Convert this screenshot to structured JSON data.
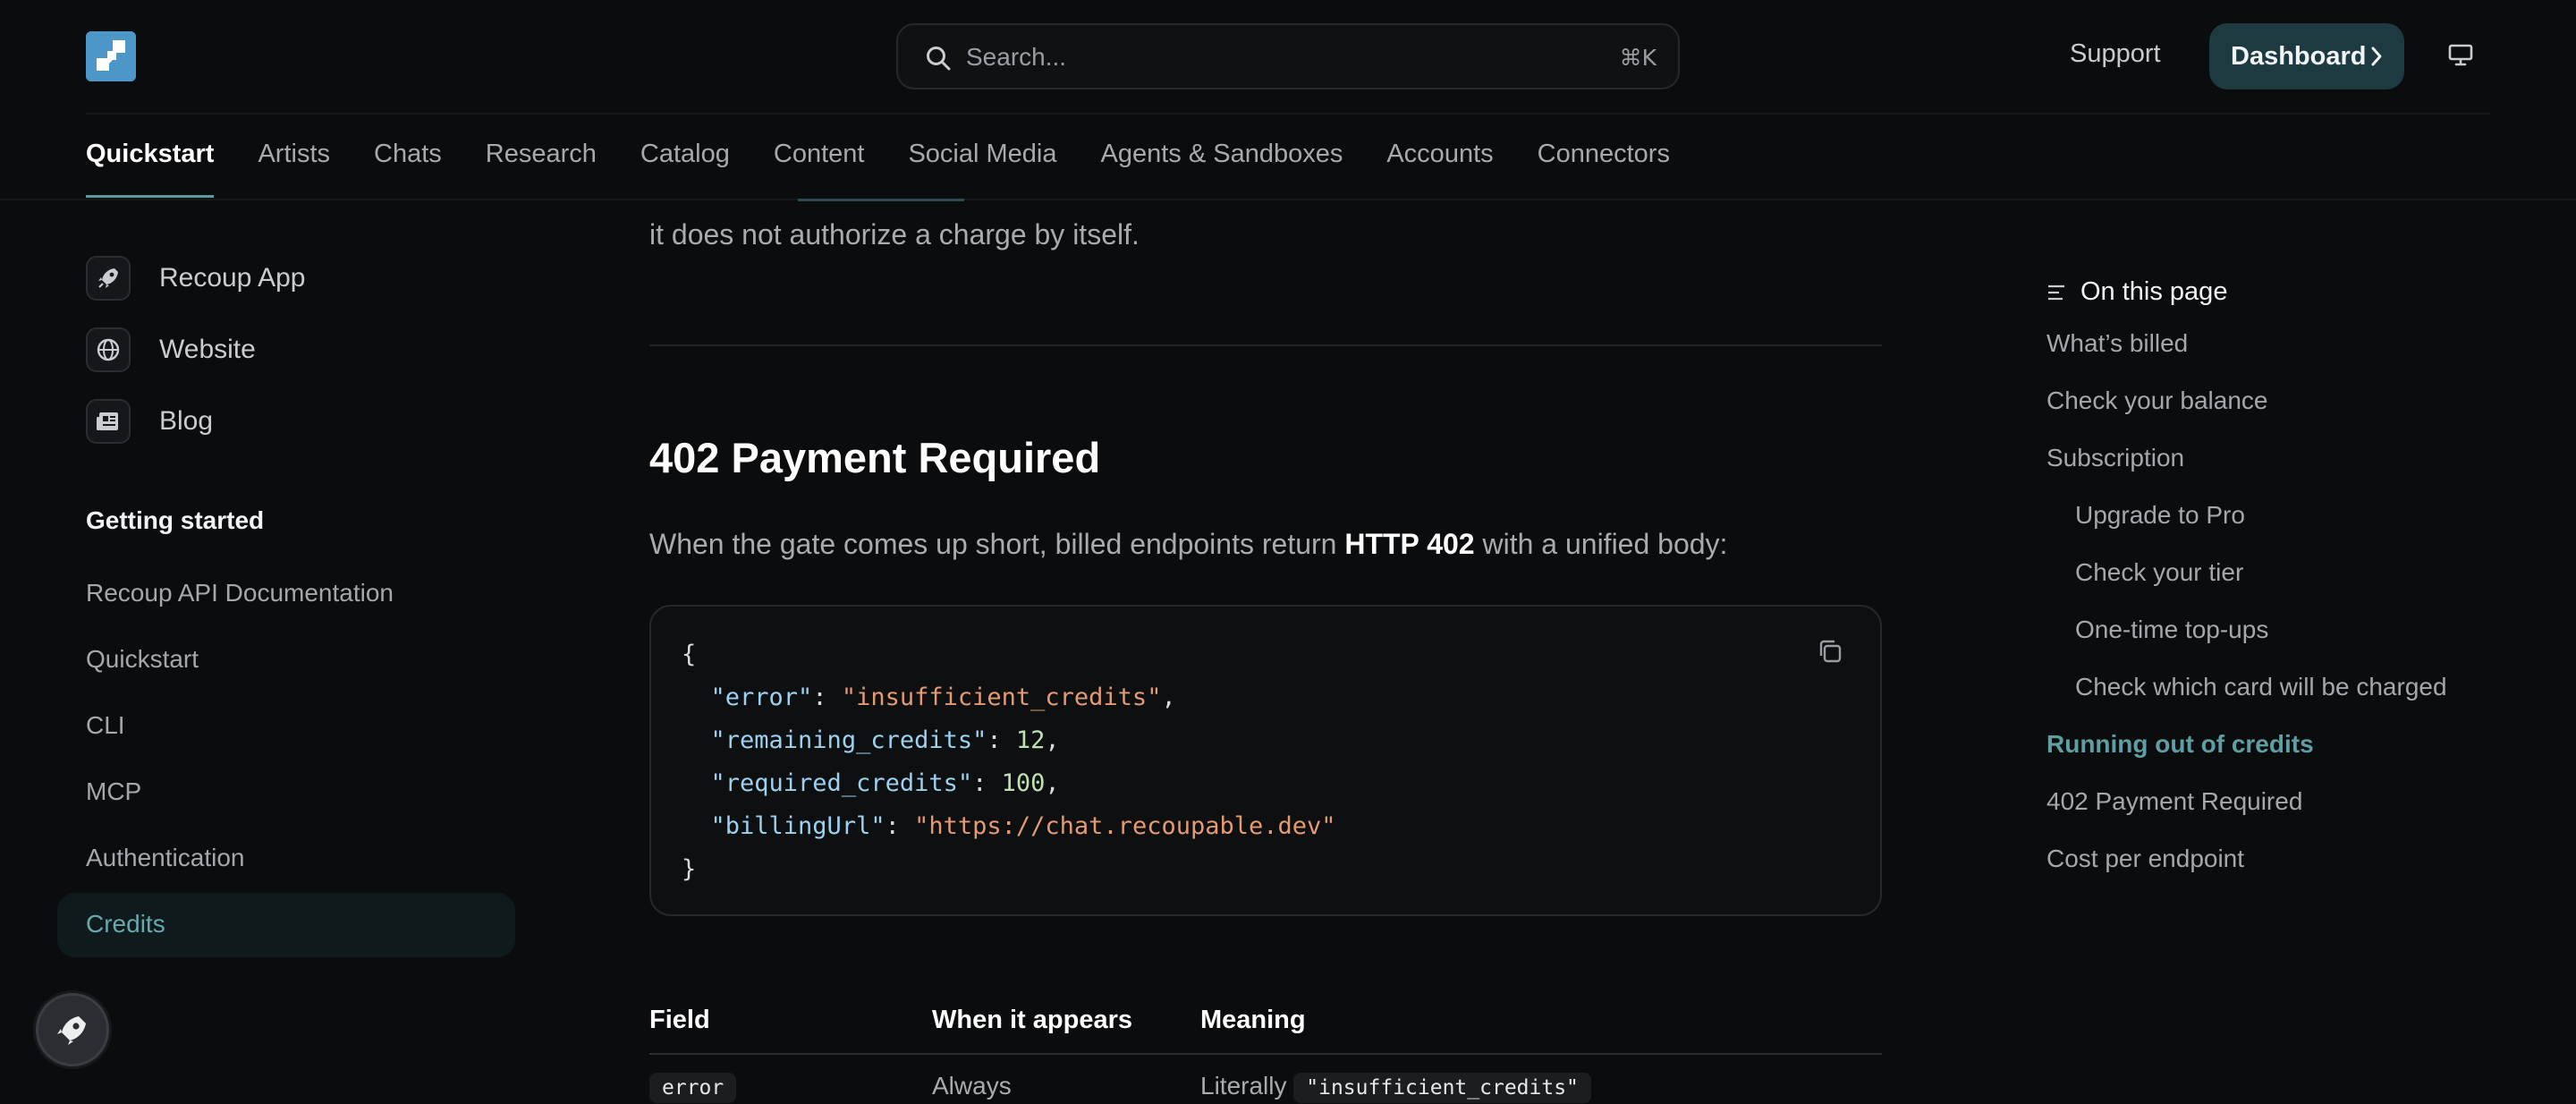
{
  "header": {
    "search_placeholder": "Search...",
    "search_shortcut": "⌘K",
    "support_label": "Support",
    "dashboard_label": "Dashboard"
  },
  "tabs": [
    {
      "label": "Quickstart",
      "active": true
    },
    {
      "label": "Artists"
    },
    {
      "label": "Chats"
    },
    {
      "label": "Research"
    },
    {
      "label": "Catalog"
    },
    {
      "label": "Content"
    },
    {
      "label": "Social Media"
    },
    {
      "label": "Agents & Sandboxes"
    },
    {
      "label": "Accounts"
    },
    {
      "label": "Connectors"
    }
  ],
  "sidebar": {
    "links": [
      {
        "label": "Recoup App",
        "icon": "rocket-icon"
      },
      {
        "label": "Website",
        "icon": "globe-icon"
      },
      {
        "label": "Blog",
        "icon": "newspaper-icon"
      }
    ],
    "section_title": "Getting started",
    "items": [
      {
        "label": "Recoup API Documentation"
      },
      {
        "label": "Quickstart"
      },
      {
        "label": "CLI"
      },
      {
        "label": "MCP"
      },
      {
        "label": "Authentication"
      },
      {
        "label": "Credits",
        "active": true
      }
    ]
  },
  "main": {
    "intro_tail": "it does not authorize a charge by itself.",
    "heading": "402 Payment Required",
    "para_before": "When the gate comes up short, billed endpoints return ",
    "para_bold": "HTTP 402",
    "para_after": " with a unified body:",
    "code": {
      "open": "{",
      "close": "}",
      "lines": [
        {
          "key": "\"error\"",
          "value": "\"insufficient_credits\"",
          "type": "string",
          "comma": ","
        },
        {
          "key": "\"remaining_credits\"",
          "value": "12",
          "type": "number",
          "comma": ","
        },
        {
          "key": "\"required_credits\"",
          "value": "100",
          "type": "number",
          "comma": ","
        },
        {
          "key": "\"billingUrl\"",
          "value": "\"https://chat.recoupable.dev\"",
          "type": "string",
          "comma": ""
        }
      ]
    },
    "table": {
      "headers": [
        "Field",
        "When it appears",
        "Meaning"
      ],
      "rows": [
        {
          "field": "error",
          "when": "Always",
          "meaning_prefix": "Literally",
          "meaning_code": "\"insufficient_credits\""
        }
      ]
    }
  },
  "toc": {
    "title": "On this page",
    "items": [
      {
        "label": "What’s billed",
        "level": 1
      },
      {
        "label": "Check your balance",
        "level": 1
      },
      {
        "label": "Subscription",
        "level": 1
      },
      {
        "label": "Upgrade to Pro",
        "level": 2
      },
      {
        "label": "Check your tier",
        "level": 2
      },
      {
        "label": "One-time top-ups",
        "level": 2
      },
      {
        "label": "Check which card will be charged",
        "level": 2
      },
      {
        "label": "Running out of credits",
        "level": 1,
        "active": true
      },
      {
        "label": "402 Payment Required",
        "level": 1
      },
      {
        "label": "Cost per endpoint",
        "level": 1
      }
    ]
  },
  "colors": {
    "background": "#0b0c0e",
    "accent": "#5f9ea3",
    "button_bg": "#1c3a3f",
    "logo": "#4d96c8"
  }
}
